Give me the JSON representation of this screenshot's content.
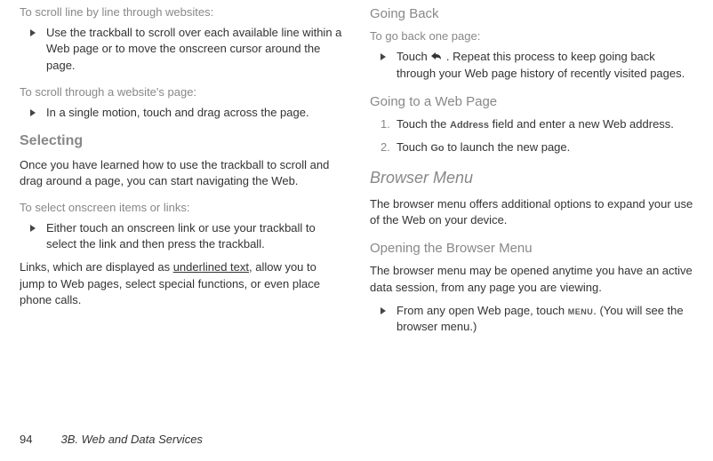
{
  "left": {
    "scroll_line_heading": "To scroll line by line through websites:",
    "scroll_line_item": "Use the trackball to scroll over each available line within a Web page or to move the onscreen cursor around the page.",
    "scroll_page_heading": "To scroll through a website's page:",
    "scroll_page_item": "In a single motion, touch and drag across the page.",
    "selecting_heading": "Selecting",
    "selecting_body": "Once you have learned how to use the trackball to scroll and drag around a page, you can start navigating the Web.",
    "select_items_heading": "To select onscreen items or links:",
    "select_items_item": "Either touch an onscreen link or use your trackball to select the link and then press the trackball.",
    "links_body_pre": "Links, which are displayed as ",
    "links_body_underlined": "underlined text",
    "links_body_post": ", allow you to jump to Web pages, select special functions, or even place phone calls."
  },
  "right": {
    "going_back_heading": "Going Back",
    "go_back_subheading": "To go back one page:",
    "go_back_pre": "Touch ",
    "go_back_post": " . Repeat this process to keep going back through your Web page history of recently visited pages.",
    "go_to_web_heading": "Going to a Web Page",
    "step1_pre": "Touch the ",
    "step1_label": "Address",
    "step1_post": " field and enter a new Web address.",
    "step2_pre": "Touch ",
    "step2_label": "Go",
    "step2_post": " to launch the new page.",
    "browser_menu_heading": "Browser Menu",
    "browser_menu_body": "The browser menu offers additional options to expand your use of the Web on your device.",
    "open_menu_heading": "Opening the Browser Menu",
    "open_menu_body": "The browser menu may be opened anytime you have an active data session, from any page you are viewing.",
    "from_any_pre": "From any open Web page, touch ",
    "from_any_label": "MENU",
    "from_any_post": ". (You will see the browser menu.)"
  },
  "footer": {
    "page_no": "94",
    "title": "3B. Web and Data Services"
  },
  "nums": {
    "one": "1.",
    "two": "2."
  }
}
